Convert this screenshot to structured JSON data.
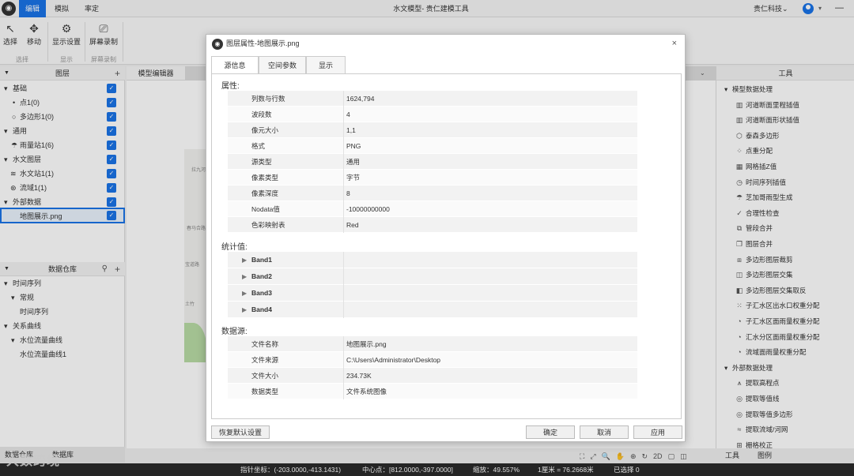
{
  "topbar": {
    "menu": [
      "编辑",
      "模拟",
      "率定"
    ],
    "title": "水文模型- 贵仁建模工具",
    "company": "贵仁科技",
    "company_dropdown": "▾",
    "minimize": "—"
  },
  "ribbon": {
    "buttons": [
      {
        "label": "选择",
        "icon": "cursor-icon"
      },
      {
        "label": "移动",
        "icon": "move-icon"
      },
      {
        "label": "显示设置",
        "icon": "gear-icon"
      },
      {
        "label": "屏幕录制",
        "icon": "camera-icon"
      }
    ],
    "groups": [
      "选择",
      "显示",
      "屏幕录制"
    ]
  },
  "layers": {
    "title": "图层",
    "items": [
      {
        "label": "基础",
        "level": 0,
        "expanded": true
      },
      {
        "label": "点1(0)",
        "level": 1,
        "icon": "dot-icon"
      },
      {
        "label": "多边形1(0)",
        "level": 1,
        "icon": "circle-icon"
      },
      {
        "label": "通用",
        "level": 0,
        "expanded": true
      },
      {
        "label": "雨量站1(6)",
        "level": 1,
        "icon": "rain-icon"
      },
      {
        "label": "水文图层",
        "level": 0,
        "expanded": true
      },
      {
        "label": "水文站1(1)",
        "level": 1,
        "icon": "wave-icon"
      },
      {
        "label": "流域1(1)",
        "level": 1,
        "icon": "basin-icon"
      },
      {
        "label": "外部数据",
        "level": 0,
        "expanded": true
      },
      {
        "label": "地图展示.png",
        "level": 1,
        "selected": true
      }
    ]
  },
  "repository": {
    "title": "数据仓库",
    "items": [
      {
        "label": "时间序列",
        "level": 0
      },
      {
        "label": "常规",
        "level": 1
      },
      {
        "label": "时间序列",
        "level": 2
      },
      {
        "label": "关系曲线",
        "level": 0
      },
      {
        "label": "水位流量曲线",
        "level": 1
      },
      {
        "label": "水位流量曲线1",
        "level": 2
      }
    ]
  },
  "left_tabs": [
    "数据仓库",
    "数据库"
  ],
  "center": {
    "tab": "模型编辑器",
    "map_labels": [
      "拉九河",
      "春马合路",
      "宝道路",
      "土竹"
    ]
  },
  "tools": {
    "title": "工具",
    "categories": [
      {
        "label": "模型数据处理",
        "items": [
          {
            "label": "河道断面里程插值",
            "icon": "chart-icon"
          },
          {
            "label": "河道断面形状插值",
            "icon": "chart-icon"
          },
          {
            "label": "泰森多边形",
            "icon": "polygon-icon"
          },
          {
            "label": "点重分配",
            "icon": "points-icon"
          },
          {
            "label": "网格插Z值",
            "icon": "grid-icon"
          },
          {
            "label": "时间序列插值",
            "icon": "clock-icon"
          },
          {
            "label": "芝加哥雨型生成",
            "icon": "rain-icon"
          },
          {
            "label": "合理性检查",
            "icon": "check-icon"
          },
          {
            "label": "管段合并",
            "icon": "merge-icon"
          },
          {
            "label": "图层合并",
            "icon": "layers-icon"
          },
          {
            "label": "多边形图层裁剪",
            "icon": "clip-icon"
          },
          {
            "label": "多边形图层交集",
            "icon": "intersect-icon"
          },
          {
            "label": "多边形图层交集取反",
            "icon": "invert-icon"
          },
          {
            "label": "子汇水区出水口权重分配",
            "icon": "outlet-icon"
          },
          {
            "label": "子汇水区面雨量权重分配",
            "icon": "pie-icon"
          },
          {
            "label": "汇水分区面雨量权重分配",
            "icon": "pie-icon"
          },
          {
            "label": "流域面雨量权重分配",
            "icon": "pie-icon"
          }
        ]
      },
      {
        "label": "外部数据处理",
        "items": [
          {
            "label": "提取高程点",
            "icon": "elevation-icon"
          },
          {
            "label": "提取等值线",
            "icon": "contour-icon"
          },
          {
            "label": "提取等值多边形",
            "icon": "contour-icon"
          },
          {
            "label": "提取流域/河网",
            "icon": "river-icon"
          },
          {
            "label": "栅格校正",
            "icon": "raster-icon"
          }
        ]
      }
    ]
  },
  "right_tabs": [
    "工具",
    "图例"
  ],
  "status": {
    "pointer": "指针坐标：(-203.0000,-413.1431)",
    "center": "中心点：[812.0000,-397.0000]",
    "zoom": "缩放：49.557%",
    "scale": "1厘米 = 76.2668米",
    "selected": "已选择 0"
  },
  "watermark": "大数跨境",
  "map_tools": [
    "⛶",
    "⤢",
    "🔍",
    "✋",
    "⊕",
    "↻",
    "2D",
    "▢",
    "◫"
  ],
  "dialog": {
    "title": "图层属性-地图展示.png",
    "close": "×",
    "tabs": [
      "源信息",
      "空间参数",
      "显示"
    ],
    "attr_title": "属性:",
    "attrs": [
      {
        "k": "列数与行数",
        "v": "1624,794"
      },
      {
        "k": "波段数",
        "v": "4"
      },
      {
        "k": "像元大小",
        "v": "1,1"
      },
      {
        "k": "格式",
        "v": "PNG"
      },
      {
        "k": "源类型",
        "v": "通用"
      },
      {
        "k": "像素类型",
        "v": "字节"
      },
      {
        "k": "像素深度",
        "v": "8"
      },
      {
        "k": "Nodata值",
        "v": "-10000000000"
      },
      {
        "k": "色彩映射表",
        "v": "Red"
      }
    ],
    "stats_title": "统计值:",
    "bands": [
      "Band1",
      "Band2",
      "Band3",
      "Band4"
    ],
    "source_title": "数据源:",
    "source": [
      {
        "k": "文件名称",
        "v": "地图展示.png"
      },
      {
        "k": "文件来源",
        "v": "C:\\Users\\Administrator\\Desktop"
      },
      {
        "k": "文件大小",
        "v": "234.73K"
      },
      {
        "k": "数据类型",
        "v": "文件系统图像"
      }
    ],
    "buttons": {
      "reset": "恢复默认设置",
      "ok": "确定",
      "cancel": "取消",
      "apply": "应用"
    }
  }
}
